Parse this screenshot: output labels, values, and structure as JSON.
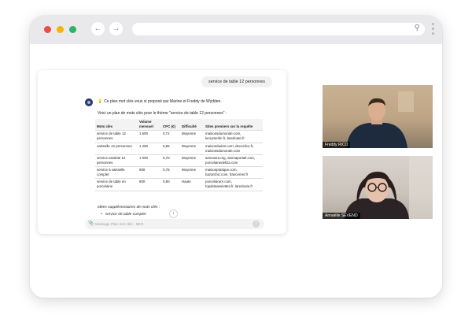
{
  "browser": {
    "back_icon": "arrow-left-icon",
    "forward_icon": "arrow-right-icon",
    "search_icon": "search-icon"
  },
  "chat": {
    "user_message": "service de table 12 personnes",
    "intro": "Ce plan mot clés vous si proposé par Marine et Freddy de Wydden.",
    "lead": "Voici un plan de mots clés pour le thème \"service de table 12 personnes\" :",
    "table": {
      "headers": [
        "Mots clés",
        "Volume mensuel",
        "CPC (€)",
        "Difficulté",
        "Sites premiers sur la requête"
      ],
      "rows": [
        [
          "service de table 12 personnes",
          "1 600",
          "0,72",
          "Moyenne",
          "maisonsdumonde.com, leroymerlin.fr, laredoute.fr"
        ],
        [
          "vaisselle 12 personnes",
          "1 200",
          "0,65",
          "Moyenne",
          "maisondudos.com, decoclico.fr, maisonsdumonde.com"
        ],
        [
          "service assiette 12 personnes",
          "1 000",
          "0,70",
          "Moyenne",
          "amenaza.org, ammaportail.com, porcelainedeliza.com"
        ],
        [
          "service à vaisselle complet",
          "900",
          "0,75",
          "Moyenne",
          "maisonpratique.com, bazarchic.com, francemer.fr"
        ],
        [
          "service de table en porcelaine",
          "800",
          "0,80",
          "Haute",
          "porcelaineX.com, topdelaassiettes.fr, laredoute.fr"
        ]
      ]
    },
    "ideas_heading": "Idées supplémentaires de mots clés :",
    "ideas": [
      "service de table complet"
    ],
    "composer_placeholder": "Message Plan mot clés - SEO"
  },
  "participants": [
    {
      "name": "Freddy RICO"
    },
    {
      "name": "Annaëlle SEVENO"
    }
  ],
  "colors": {
    "close": "#f04a4a",
    "minimize": "#f4b40b",
    "maximize": "#2bb36b",
    "titlebar": "#e9e9eb"
  }
}
